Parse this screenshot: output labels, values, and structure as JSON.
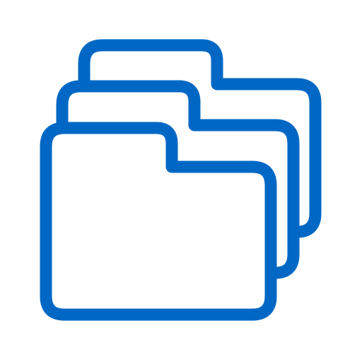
{
  "icon": {
    "name": "folders-icon",
    "stroke_color": "#0068c4",
    "fill_color": "#ffffff"
  }
}
